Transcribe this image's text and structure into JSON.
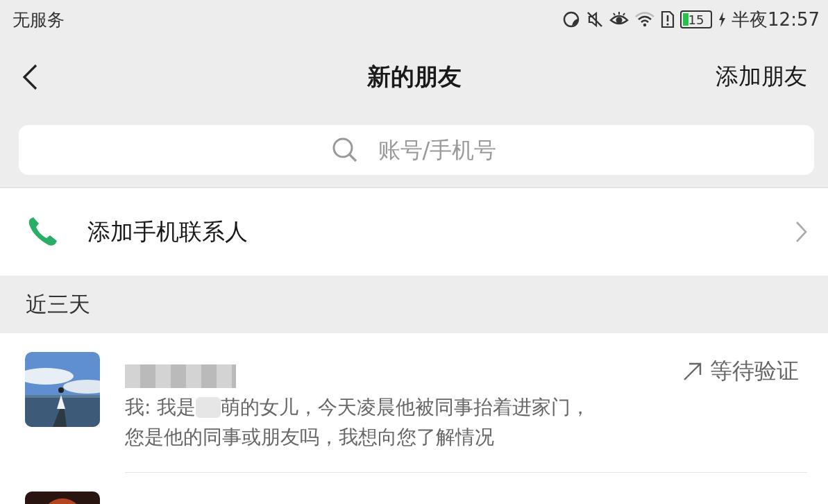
{
  "status_bar": {
    "carrier": "无服务",
    "battery": "15",
    "time": "半夜12:57"
  },
  "header": {
    "title": "新的朋友",
    "action": "添加朋友"
  },
  "search": {
    "placeholder": "账号/手机号"
  },
  "add_contacts": {
    "label": "添加手机联系人"
  },
  "section": {
    "title": "近三天"
  },
  "requests": [
    {
      "avatar": {
        "kind": "picture"
      },
      "message": {
        "before_redaction": "我: 我是",
        "after_redaction": "萌的女儿，今天凌晨他被同事抬着进家门，",
        "second_line": "您是他的同事或朋友吗，我想向您了解情况"
      },
      "status": "等待验证"
    },
    {
      "avatar": {
        "kind": "picture"
      }
    }
  ]
}
